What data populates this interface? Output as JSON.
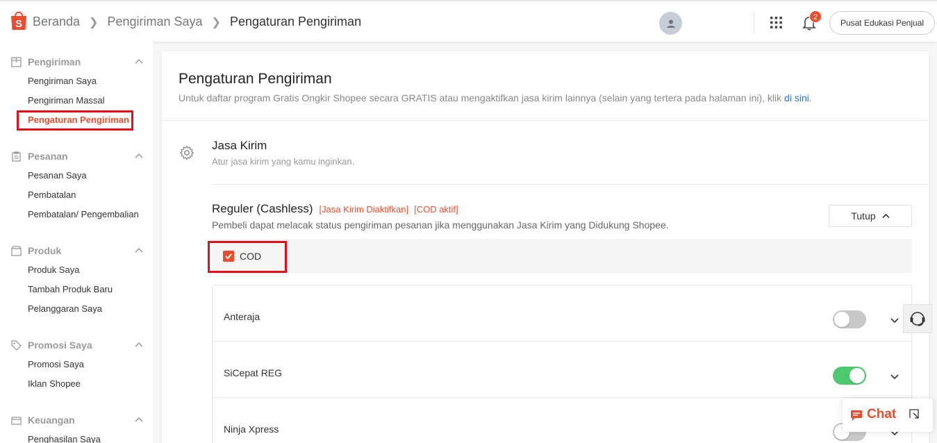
{
  "header": {
    "breadcrumbs": [
      "Beranda",
      "Pengiriman Saya",
      "Pengaturan Pengiriman"
    ],
    "notification_count": "2",
    "edu_button": "Pusat Edukasi Penjual",
    "brand_color": "#ee4d2d"
  },
  "sidebar": {
    "sections": [
      {
        "title": "Pengiriman",
        "icon": "package-icon",
        "items": [
          "Pengiriman Saya",
          "Pengiriman Massal",
          "Pengaturan Pengiriman"
        ],
        "active": "Pengaturan Pengiriman"
      },
      {
        "title": "Pesanan",
        "icon": "clipboard-icon",
        "items": [
          "Pesanan Saya",
          "Pembatalan",
          "Pembatalan/ Pengembalian"
        ]
      },
      {
        "title": "Produk",
        "icon": "box-icon",
        "items": [
          "Produk Saya",
          "Tambah Produk Baru",
          "Pelanggaran Saya"
        ]
      },
      {
        "title": "Promosi Saya",
        "icon": "tag-icon",
        "items": [
          "Promosi Saya",
          "Iklan Shopee"
        ]
      },
      {
        "title": "Keuangan",
        "icon": "wallet-icon",
        "items": [
          "Penghasilan Saya"
        ]
      }
    ]
  },
  "main": {
    "title": "Pengaturan Pengiriman",
    "subtitle_text": "Untuk daftar program Gratis Ongkir Shopee secara GRATIS atau mengaktifkan jasa kirim lainnya (selain yang tertera pada halaman ini), klik ",
    "subtitle_link": "di sini",
    "subtitle_end": ".",
    "jasa_kirim": {
      "title": "Jasa Kirim",
      "subtitle": "Atur jasa kirim yang kamu inginkan."
    },
    "reguler": {
      "title": "Reguler (Cashless)",
      "tag1": "[Jasa Kirim Diaktifkan]",
      "tag2": "[COD aktif]",
      "description": "Pembeli dapat melacak status pengiriman pesanan jika menggunakan Jasa Kirim yang Didukung Shopee.",
      "collapse_button": "Tutup",
      "cod_label": "COD",
      "cod_checked": true
    },
    "couriers": [
      {
        "name": "Anteraja",
        "enabled": false
      },
      {
        "name": "SiCepat REG",
        "enabled": true
      },
      {
        "name": "Ninja Xpress",
        "enabled": false
      }
    ]
  },
  "chat": {
    "label": "Chat"
  }
}
